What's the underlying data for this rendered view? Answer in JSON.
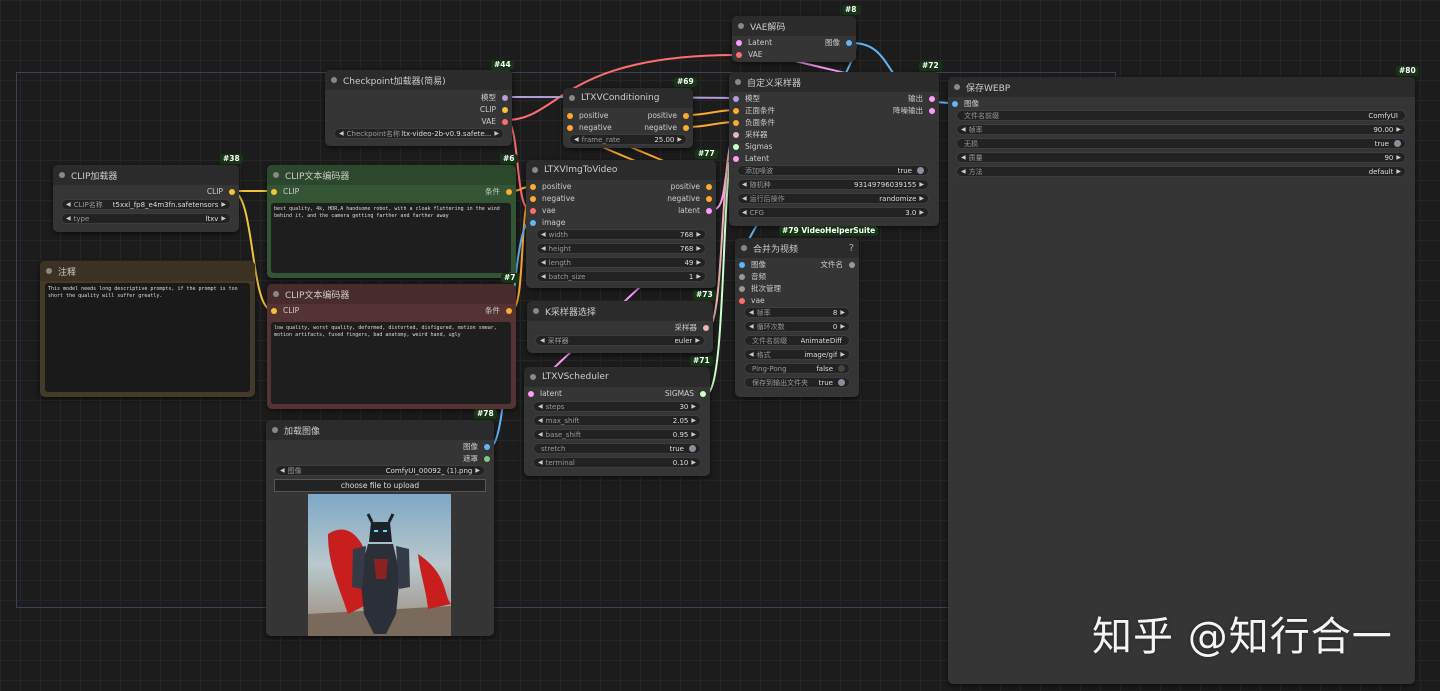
{
  "nodes": {
    "vae_decode": {
      "id": "#8",
      "title": "VAE解码",
      "inputs": [
        "Latent",
        "VAE"
      ],
      "output": "图像"
    },
    "checkpoint": {
      "id": "#44",
      "title": "Checkpoint加载器(简易)",
      "outputs": [
        "模型",
        "CLIP",
        "VAE"
      ],
      "ckpt_label": "Checkpoint名称",
      "ckpt_value": "ltx-video-2b-v0.9.safete..."
    },
    "ltxv_conditioning": {
      "id": "#69",
      "title": "LTXVConditioning",
      "inputs": [
        "positive",
        "negative"
      ],
      "outputs": [
        "positive",
        "negative"
      ],
      "frame_rate_label": "frame_rate",
      "frame_rate_value": "25.00"
    },
    "custom_sampler": {
      "id": "#72",
      "title": "自定义采样器",
      "inputs": [
        "模型",
        "正面条件",
        "负面条件",
        "采样器",
        "Sigmas",
        "Latent"
      ],
      "outputs": [
        "输出",
        "降噪输出"
      ],
      "widgets": [
        {
          "label": "添加噪波",
          "value": "true"
        },
        {
          "label": "随机种",
          "value": "931497960391​55"
        },
        {
          "label": "运行后操作",
          "value": "randomize"
        },
        {
          "label": "CFG",
          "value": "3.0"
        }
      ]
    },
    "save_webp": {
      "id": "#80",
      "title": "保存WEBP",
      "input": "图像",
      "widgets": [
        {
          "label": "文件名前缀",
          "value": "ComfyUI"
        },
        {
          "label": "帧率",
          "value": "90.00"
        },
        {
          "label": "无损",
          "value": "true"
        },
        {
          "label": "质量",
          "value": "90"
        },
        {
          "label": "方法",
          "value": "default"
        }
      ]
    },
    "clip_loader": {
      "id": "#38",
      "title": "CLIP加载器",
      "output": "CLIP",
      "clip_label": "CLIP名称",
      "clip_value": "t5xxl_fp8_e4m3fn.safetensors",
      "type_label": "type",
      "type_value": "ltxv"
    },
    "clip_encode_pos": {
      "id": "#6",
      "title": "CLIP文本编码器",
      "input": "CLIP",
      "output": "条件",
      "text": "best quality, 4k, HDR,A handsome robot, with a cloak fluttering in the wind behind it, and the camera getting farther and farther away"
    },
    "clip_encode_neg": {
      "id": "#7",
      "title": "CLIP文本编码器",
      "input": "CLIP",
      "output": "条件",
      "text": "low quality, worst quality, deformed, distorted, disfigured, motion smear, motion artifacts, fused fingers, bad anatomy, weird hand, ugly"
    },
    "note": {
      "title": "注释",
      "text": "This model needs long descriptive prompts, if the prompt is too short the quality will suffer greatly."
    },
    "ltxv_img2video": {
      "id": "#77",
      "title": "LTXVImgToVideo",
      "inputs": [
        "positive",
        "negative",
        "vae",
        "image"
      ],
      "outputs": [
        "positive",
        "negative",
        "latent"
      ],
      "widgets": [
        {
          "label": "width",
          "value": "768"
        },
        {
          "label": "height",
          "value": "768"
        },
        {
          "label": "length",
          "value": "49"
        },
        {
          "label": "batch_size",
          "value": "1"
        }
      ]
    },
    "video_combine": {
      "id": "#79 VideoHelperSuite",
      "title": "合并为视频",
      "help": "?",
      "inputs": [
        "图像",
        "音频",
        "批次管理",
        "vae"
      ],
      "output": "文件名",
      "widgets": [
        {
          "label": "帧率",
          "value": "8"
        },
        {
          "label": "循环次数",
          "value": "0"
        },
        {
          "label": "文件名前缀",
          "value": "AnimateDiff"
        },
        {
          "label": "格式",
          "value": "image/gif"
        },
        {
          "label": "Ping-Pong",
          "value": "false"
        },
        {
          "label": "保存到输出文件夹",
          "value": "true"
        }
      ]
    },
    "ksampler_select": {
      "id": "#73",
      "title": "K采样器选择",
      "output": "采样器",
      "sampler_label": "采样器",
      "sampler_value": "euler"
    },
    "ltxv_scheduler": {
      "id": "#71",
      "title": "LTXVScheduler",
      "input": "latent",
      "output": "SIGMAS",
      "widgets": [
        {
          "label": "steps",
          "value": "30"
        },
        {
          "label": "max_shift",
          "value": "2.05"
        },
        {
          "label": "base_shift",
          "value": "0.95"
        },
        {
          "label": "stretch",
          "value": "true"
        },
        {
          "label": "terminal",
          "value": "0.10"
        }
      ]
    },
    "load_image": {
      "id": "#78",
      "title": "加载图像",
      "outputs": [
        "图像",
        "遮罩"
      ],
      "image_label": "图像",
      "image_value": "ComfyUI_00092_ (1).png",
      "upload_label": "choose file to upload"
    }
  },
  "watermark": "知乎 @知行合一",
  "colors": {
    "clip": "#f5c33b",
    "conditioning": "#ffa931",
    "vae": "#ff6e6e",
    "model": "#b39ddb",
    "image": "#64b5f6",
    "latent": "#ff9cf9",
    "sampler": "#ecb4b4",
    "sigmas": "#cdffcd",
    "mask": "#81c784"
  }
}
